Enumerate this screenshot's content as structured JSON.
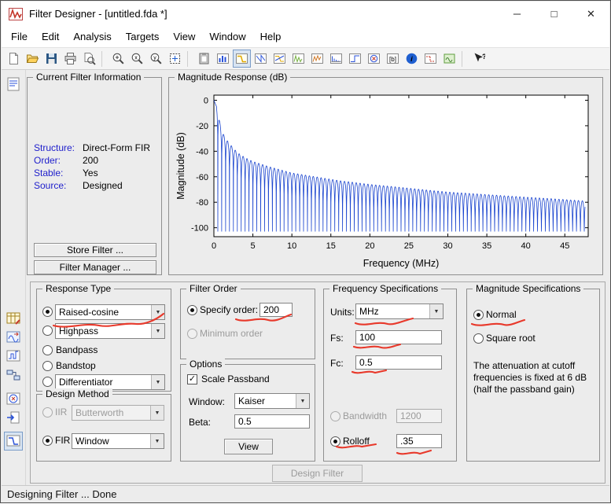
{
  "window": {
    "title": "Filter Designer -  [untitled.fda *]",
    "minimize": "─",
    "maximize": "□",
    "close": "✕"
  },
  "menu": {
    "items": [
      "File",
      "Edit",
      "Analysis",
      "Targets",
      "View",
      "Window",
      "Help"
    ]
  },
  "toolbar": {
    "icons": [
      "new-session",
      "open-session",
      "save-session",
      "print",
      "print-preview",
      "zoom-in",
      "zoom-x",
      "zoom-y",
      "full-view",
      "copy",
      "filter-manager",
      "magnitude-response",
      "phase-response",
      "magnitude-and-phase",
      "group-delay",
      "phase-delay",
      "impulse-response",
      "step-response",
      "pole-zero-plot",
      "filter-coefficients",
      "filter-information",
      "spec-mask",
      "sos-view",
      "context-help"
    ],
    "selected": "magnitude-response"
  },
  "sidebar": {
    "icons": [
      "filter-specs",
      "set-quantization",
      "transform-filter",
      "multirate",
      "realize-model",
      "pole-zero-editor",
      "import-filter",
      "design-filter-panel"
    ],
    "selected": "design-filter-panel"
  },
  "current_filter_info": {
    "title": "Current Filter Information",
    "structure_label": "Structure:",
    "structure_value": "Direct-Form FIR",
    "order_label": "Order:",
    "order_value": "200",
    "stable_label": "Stable:",
    "stable_value": "Yes",
    "source_label": "Source:",
    "source_value": "Designed",
    "store_filter_button": "Store Filter ...",
    "filter_manager_button": "Filter Manager ..."
  },
  "chart_data": {
    "type": "line",
    "title": "Magnitude Response (dB)",
    "xlabel": "Frequency (MHz)",
    "ylabel": "Magnitude (dB)",
    "xlim": [
      0,
      48
    ],
    "ylim": [
      -107,
      4
    ],
    "xticks": [
      0,
      5,
      10,
      15,
      20,
      25,
      30,
      35,
      40,
      45
    ],
    "yticks": [
      0,
      -20,
      -40,
      -60,
      -80,
      -100
    ],
    "grid": false,
    "legend": false,
    "line_color": "#1b45cf",
    "lobe_spacing": 0.5,
    "data_xmax": 47.6,
    "null_floor": -103,
    "envelope_db": [
      [
        0,
        0
      ],
      [
        0.4,
        -6
      ],
      [
        0.75,
        -17
      ],
      [
        1,
        -24
      ],
      [
        1.5,
        -30
      ],
      [
        2,
        -34
      ],
      [
        3,
        -41
      ],
      [
        4,
        -45
      ],
      [
        5,
        -48
      ],
      [
        7,
        -52
      ],
      [
        10,
        -57
      ],
      [
        13,
        -60
      ],
      [
        16,
        -63
      ],
      [
        20,
        -66
      ],
      [
        25,
        -69
      ],
      [
        30,
        -72
      ],
      [
        35,
        -74
      ],
      [
        40,
        -76
      ],
      [
        44,
        -77.5
      ],
      [
        47.6,
        -79
      ]
    ],
    "description": "Magnitude response of order-200 raised-cosine FIR lowpass (Fs=100 MHz, Fc=0.5 MHz, rolloff .35): dense sidelobes spaced 0.5 MHz apart, peaks decaying from 0 dB to about -79 dB, nulls reaching below -100 dB"
  },
  "response_type": {
    "title": "Response Type",
    "lowpass_combo": "Raised-cosine",
    "highpass_combo": "Highpass",
    "bandpass_label": "Bandpass",
    "bandstop_label": "Bandstop",
    "differentiator_combo": "Differentiator",
    "selected": "Raised-cosine"
  },
  "design_method": {
    "title": "Design Method",
    "iir_label": "IIR",
    "iir_combo": "Butterworth",
    "fir_label": "FIR",
    "fir_combo": "Window",
    "selected": "FIR"
  },
  "filter_order": {
    "title": "Filter Order",
    "specify_label": "Specify order:",
    "specify_value": "200",
    "minimum_label": "Minimum order",
    "selected": "specify"
  },
  "options": {
    "title": "Options",
    "scale_passband_label": "Scale Passband",
    "scale_passband_checked": true,
    "window_label": "Window:",
    "window_value": "Kaiser",
    "beta_label": "Beta:",
    "beta_value": "0.5",
    "view_button": "View"
  },
  "frequency_specs": {
    "title": "Frequency Specifications",
    "units_label": "Units:",
    "units_value": "MHz",
    "fs_label": "Fs:",
    "fs_value": "100",
    "fc_label": "Fc:",
    "fc_value": "0.5",
    "bandwidth_label": "Bandwidth",
    "bandwidth_value": "1200",
    "rolloff_label": "Rolloff",
    "rolloff_value": ".35",
    "selected_radio": "Rolloff"
  },
  "magnitude_specs": {
    "title": "Magnitude Specifications",
    "normal_label": "Normal",
    "square_root_label": "Square root",
    "note": "The attenuation at cutoff frequencies is fixed at 6 dB (half the passband gain)",
    "selected": "Normal"
  },
  "design_filter_button": "Design Filter",
  "status": {
    "text": "Designing Filter ... Done"
  },
  "annotations": {
    "color": "#e8392b",
    "marked_items": [
      "Raised-cosine",
      "Specify order: 200",
      "Units: MHz",
      "Fs: 100",
      "Fc: 0.5",
      "Normal",
      "Rolloff",
      ".35"
    ]
  }
}
